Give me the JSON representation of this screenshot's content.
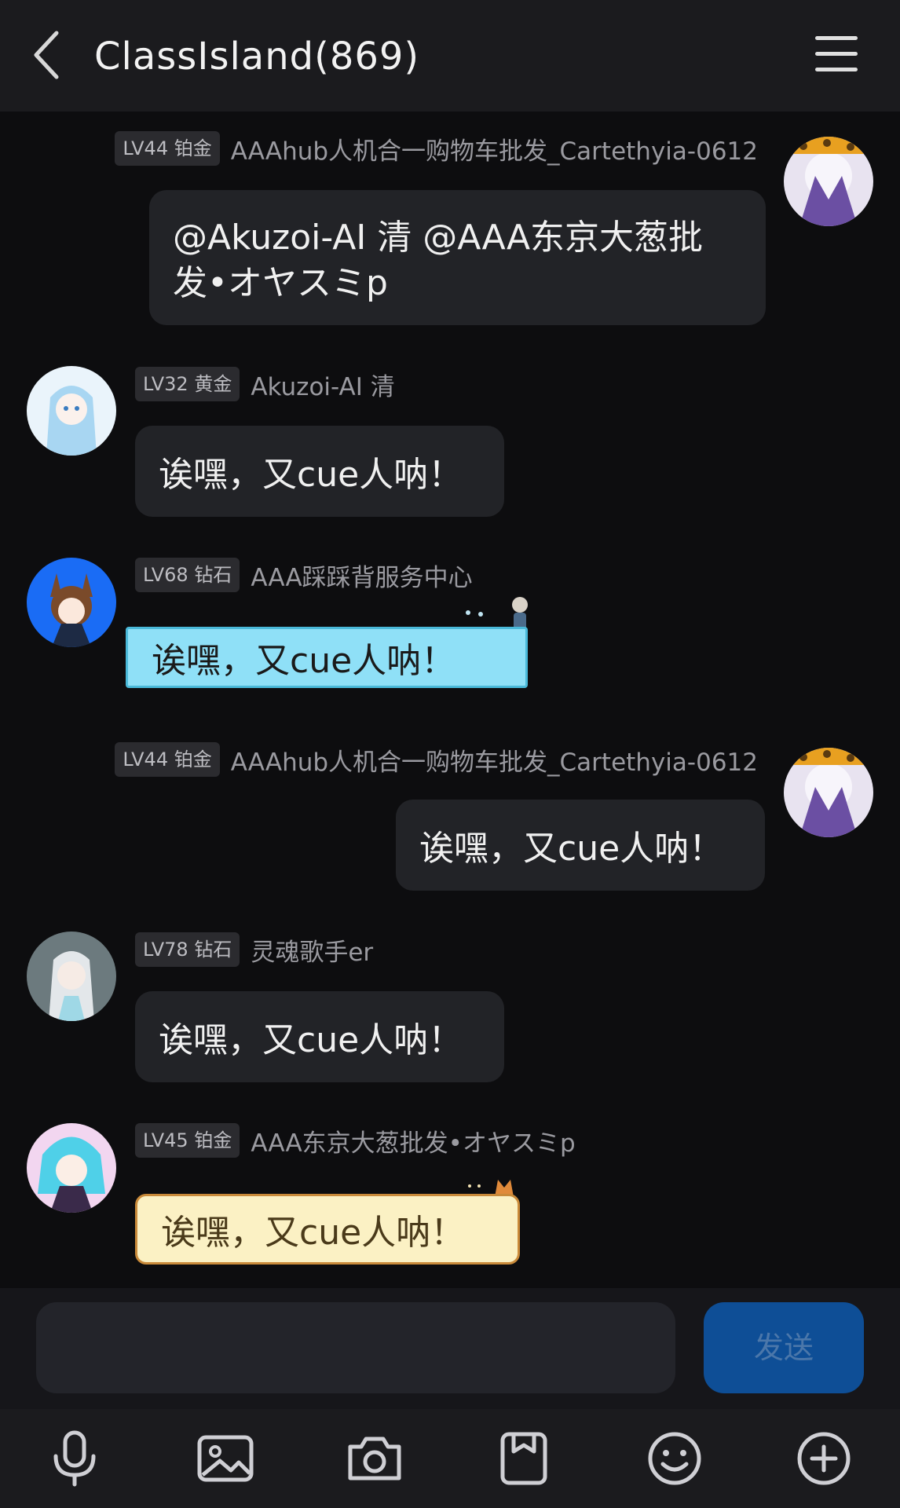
{
  "header": {
    "title": "ClassIsland(869)"
  },
  "messages": [
    {
      "side": "right",
      "level": "LV44 铂金",
      "name": "AAAhub人机合一购物车批发_Cartethyia-0612",
      "text_line1": "@Akuzoi-AI 清 @AAA东京大葱批",
      "text_line2": "发•オヤスミp"
    },
    {
      "side": "left",
      "level": "LV32 黄金",
      "name": "Akuzoi-AI 清",
      "text": "诶嘿，又cue人呐！"
    },
    {
      "side": "left",
      "level": "LV68 钻石",
      "name": "AAA踩踩背服务中心",
      "text": "诶嘿，又cue人呐！",
      "style": "blue"
    },
    {
      "side": "right",
      "level": "LV44 铂金",
      "name": "AAAhub人机合一购物车批发_Cartethyia-0612",
      "text": "诶嘿，又cue人呐！"
    },
    {
      "side": "left",
      "level": "LV78 钻石",
      "name": "灵魂歌手er",
      "text": "诶嘿，又cue人呐！"
    },
    {
      "side": "left",
      "level": "LV45 铂金",
      "name": "AAA东京大葱批发•オヤスミp",
      "text": "诶嘿，又cue人呐！",
      "style": "cream"
    }
  ],
  "composer": {
    "input_value": "",
    "send_label": "发送"
  },
  "toolbar": {
    "icons": [
      "microphone-icon",
      "image-icon",
      "camera-icon",
      "sticker-icon",
      "emoji-icon",
      "plus-icon"
    ]
  },
  "colors": {
    "background": "#0d0d0f",
    "bubble": "#222327",
    "send_button": "#0e4e96",
    "blue_bubble": "#8fe0f7",
    "cream_bubble": "#fbf1c4"
  }
}
